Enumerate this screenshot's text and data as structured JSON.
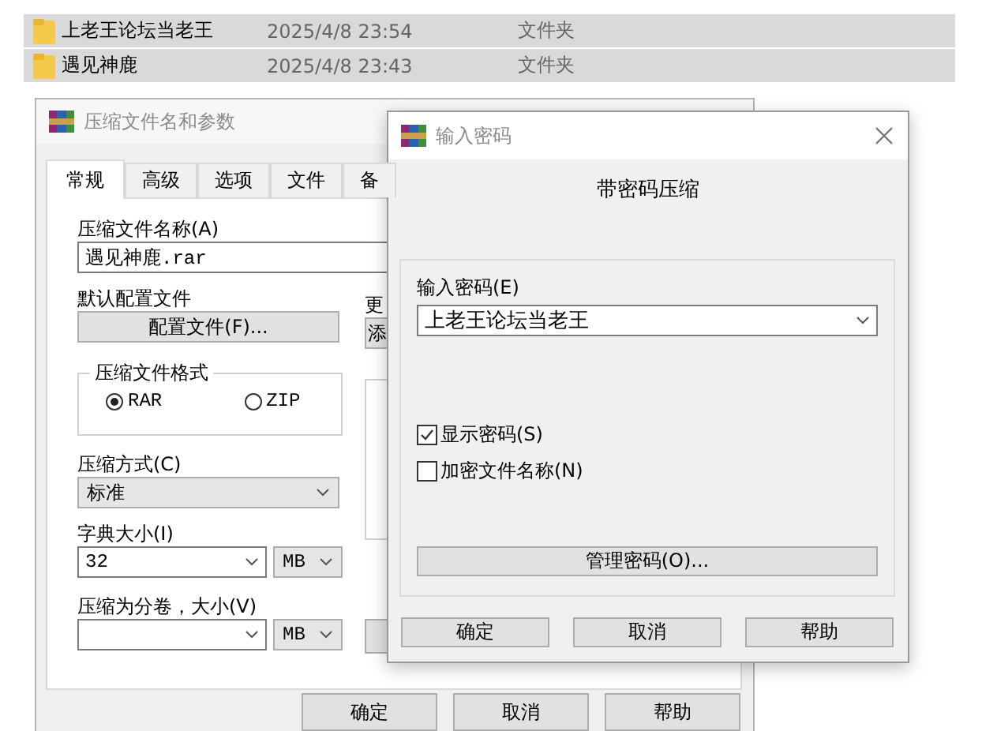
{
  "file_list": {
    "rows": [
      {
        "name": "上老王论坛当老王",
        "modified": "2025/4/8 23:54",
        "type": "文件夹",
        "selected": true
      },
      {
        "name": "遇见神鹿",
        "modified": "2025/4/8 23:43",
        "type": "文件夹",
        "selected": true
      }
    ]
  },
  "archive_dialog": {
    "title": "压缩文件名和参数",
    "tabs": [
      {
        "label": "常规",
        "selected": true
      },
      {
        "label": "高级",
        "selected": false
      },
      {
        "label": "选项",
        "selected": false
      },
      {
        "label": "文件",
        "selected": false
      },
      {
        "label": "备",
        "selected": false
      }
    ],
    "archive_name_label": "压缩文件名称(A)",
    "archive_name": "遇见神鹿.rar",
    "profile_label": "默认配置文件",
    "profile_button": "配置文件(F)...",
    "update_label": "更",
    "add_button": "添",
    "format_group": {
      "title": "压缩文件格式",
      "options": [
        {
          "label": "RAR",
          "selected": true
        },
        {
          "label": "ZIP",
          "selected": false
        }
      ]
    },
    "method_label": "压缩方式(C)",
    "method": "标准",
    "dictionary_label": "字典大小(I)",
    "dictionary_size": "32",
    "dictionary_unit": "MB",
    "volume_label": "压缩为分卷，大小(V)",
    "volume_unit": "MB",
    "buttons": [
      "确定",
      "取消",
      "帮助"
    ]
  },
  "password_dialog": {
    "title": "输入密码",
    "heading": "带密码压缩",
    "password_label": "输入密码(E)",
    "password": "上老王论坛当老王",
    "options": [
      {
        "label": "显示密码(S)",
        "checked": true
      },
      {
        "label": "加密文件名称(N)",
        "checked": false
      }
    ],
    "manage_button": "管理密码(O)...",
    "buttons": [
      "确定",
      "取消",
      "帮助"
    ]
  }
}
